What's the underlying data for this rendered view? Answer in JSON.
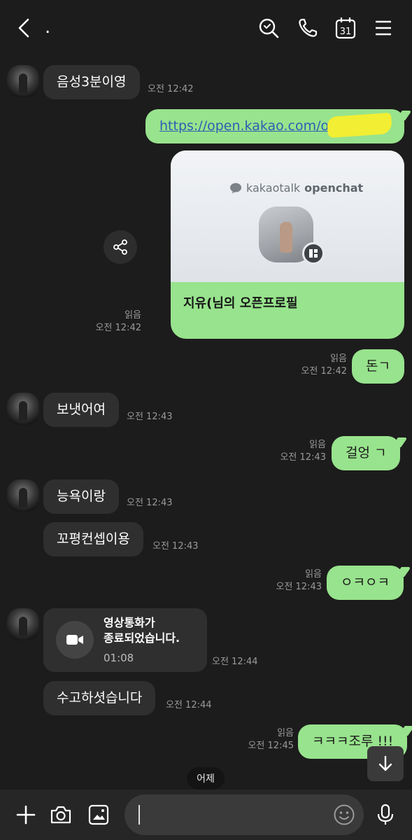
{
  "header": {
    "title": ".",
    "calendar_day": "31",
    "icons": [
      "back-arrow-icon",
      "search-icon",
      "phone-icon",
      "calendar-icon",
      "menu-icon"
    ]
  },
  "messages": {
    "m1": {
      "text": "음성3분이영",
      "time": "오전 12:42"
    },
    "m2": {
      "text": "https://open.kakao.com/o/s"
    },
    "card": {
      "brand_light": "kakaotalk",
      "brand_bold": "openchat",
      "name": "지유(님의 오픈프로필",
      "read": "읽음",
      "time": "오전 12:42"
    },
    "m3": {
      "text": "돈ㄱ",
      "read": "읽음",
      "time": "오전 12:42"
    },
    "m4": {
      "text": "보냇어여",
      "time": "오전 12:43"
    },
    "m5": {
      "text": "걸엉 ㄱ",
      "read": "읽음",
      "time": "오전 12:43"
    },
    "m6": {
      "text": "능욕이랑",
      "time": "오전 12:43"
    },
    "m7": {
      "text": "꼬평컨셉이용",
      "time": "오전 12:43"
    },
    "m8": {
      "text": "ㅇㅋㅇㅋ",
      "read": "읽음",
      "time": "오전 12:43"
    },
    "vcall": {
      "line1": "영상통화가",
      "line2": "종료되었습니다.",
      "duration": "01:08",
      "time": "오전 12:44"
    },
    "m9": {
      "text": "수고하셧습니다",
      "time": "오전 12:44"
    },
    "m10": {
      "text": "ㅋㅋㅋ조루 !!!",
      "read": "읽음",
      "time": "오전 12:45"
    }
  },
  "date_pill": "어제",
  "input": {
    "placeholder": ""
  },
  "colors": {
    "background": "#1c1c1c",
    "incoming_bubble": "#2f2f2f",
    "outgoing_bubble": "#98e38d",
    "link": "#2b5fb3"
  }
}
